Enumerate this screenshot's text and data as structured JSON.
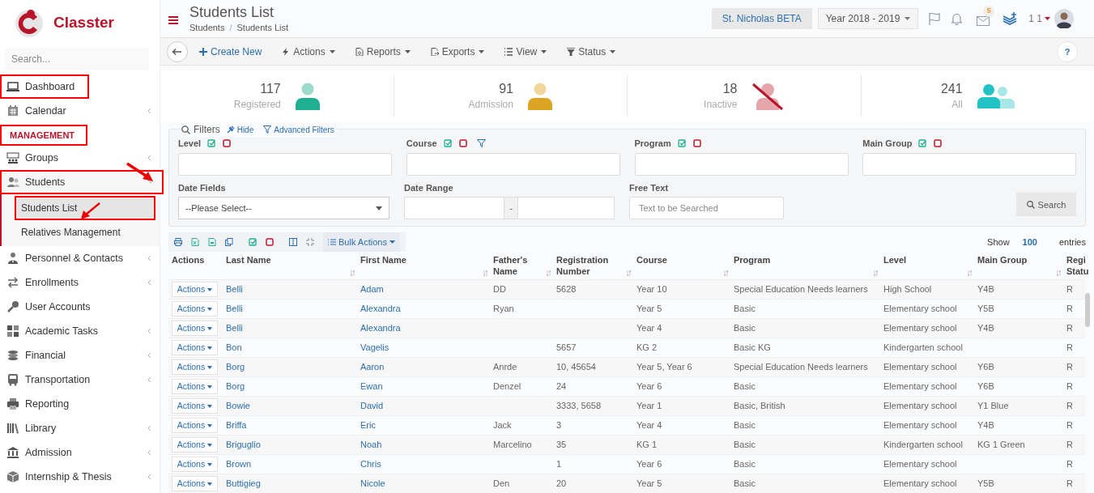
{
  "brand": {
    "name": "Classter"
  },
  "sidebar": {
    "search": {
      "placeholder": "Search..."
    },
    "items": [
      {
        "kind": "link",
        "label": "Dashboard",
        "annotated": true,
        "selected": false
      },
      {
        "kind": "link",
        "label": "Calendar",
        "annotated": false,
        "selected": false,
        "expanded": false
      },
      {
        "kind": "section",
        "label": "MANAGEMENT",
        "annotated": true
      },
      {
        "kind": "link",
        "label": "Groups",
        "annotated": false,
        "selected": false,
        "expanded": false
      },
      {
        "kind": "link",
        "label": "Students",
        "annotated": true,
        "selected": false,
        "expanded": true,
        "children": [
          {
            "label": "Students List",
            "selected": true,
            "annotated": true
          },
          {
            "label": "Relatives Management",
            "selected": false,
            "annotated": false
          }
        ]
      },
      {
        "kind": "link",
        "label": "Personnel & Contacts",
        "annotated": false,
        "selected": false,
        "expanded": false
      },
      {
        "kind": "link",
        "label": "Enrollments",
        "annotated": false,
        "selected": false,
        "expanded": false
      },
      {
        "kind": "link",
        "label": "User Accounts",
        "annotated": false,
        "selected": false
      },
      {
        "kind": "link",
        "label": "Academic Tasks",
        "annotated": false,
        "selected": false,
        "expanded": false
      },
      {
        "kind": "link",
        "label": "Financial",
        "annotated": false,
        "selected": false,
        "expanded": false
      },
      {
        "kind": "link",
        "label": "Transportation",
        "annotated": false,
        "selected": false,
        "expanded": false
      },
      {
        "kind": "link",
        "label": "Reporting",
        "annotated": false,
        "selected": false
      },
      {
        "kind": "link",
        "label": "Library",
        "annotated": false,
        "selected": false,
        "expanded": false
      },
      {
        "kind": "link",
        "label": "Admission",
        "annotated": false,
        "selected": false,
        "expanded": false
      },
      {
        "kind": "link",
        "label": "Internship & Thesis",
        "annotated": false,
        "selected": false,
        "expanded": false
      }
    ]
  },
  "header": {
    "title": "Students List",
    "breadcrumb": [
      "Students",
      "Students List"
    ],
    "breadcrumb_separator": "/",
    "school": "St. Nicholas BETA",
    "year": "Year 2018 - 2019",
    "mail_badge": "5",
    "user": "1 1"
  },
  "toolbar": [
    "Create New",
    "Actions",
    "Reports",
    "Exports",
    "View",
    "Status"
  ],
  "help": "?",
  "stats": [
    {
      "count": "117",
      "label": "Registered",
      "kind": "person",
      "color": "#1fb091"
    },
    {
      "count": "91",
      "label": "Admission",
      "kind": "person",
      "color": "#dba422"
    },
    {
      "count": "18",
      "label": "Inactive",
      "kind": "crossed",
      "color": "#e4a5ab"
    },
    {
      "count": "241",
      "label": "All",
      "kind": "group",
      "color": "#22c2c5"
    }
  ],
  "filters": {
    "title": "Filters",
    "hide": "Hide",
    "advanced": "Advanced Filters",
    "fields": [
      {
        "label": "Level",
        "funnel": false
      },
      {
        "label": "Course",
        "funnel": true
      },
      {
        "label": "Program",
        "funnel": false
      },
      {
        "label": "Main Group",
        "funnel": false
      }
    ],
    "date_fields": {
      "label": "Date Fields",
      "value": "--Please Select--"
    },
    "date_range": {
      "label": "Date Range",
      "separator": "-"
    },
    "free_text": {
      "label": "Free Text",
      "placeholder": "Text to be Searched"
    },
    "search_button": "Search"
  },
  "table": {
    "bulk_actions": "Bulk Actions",
    "show": "Show",
    "page_size": "100",
    "entries": "entries",
    "columns": [
      "Actions",
      "Last Name",
      "First Name",
      "Father's Name",
      "Registration Number",
      "Course",
      "Program",
      "Level",
      "Main Group",
      "Regi Statu"
    ],
    "rows": [
      [
        "Actions",
        "Belli",
        "Adam",
        "DD",
        "5628",
        "Year 10",
        "Special Education Needs learners",
        "High School",
        "Y4B",
        "R"
      ],
      [
        "Actions",
        "Belli",
        "Alexandra",
        "Ryan",
        "",
        "Year 5",
        "Basic",
        "Elementary school",
        "Y5B",
        "R"
      ],
      [
        "Actions",
        "Belli",
        "Alexandra",
        "",
        "",
        "Year 4",
        "Basic",
        "Elementary school",
        "Y4B",
        "R"
      ],
      [
        "Actions",
        "Bon",
        "Vagelis",
        "",
        "5657",
        "KG 2",
        "Basic KG",
        "Kindergarten school",
        "",
        "R"
      ],
      [
        "Actions",
        "Borg",
        "Aaron",
        "Anrde",
        "10, 45654",
        "Year 5, Year 6",
        "Special Education Needs learners",
        "Elementary school",
        "Y6B",
        "R"
      ],
      [
        "Actions",
        "Borg",
        "Ewan",
        "Denzel",
        "24",
        "Year 6",
        "Basic",
        "Elementary school",
        "Y6B",
        "R"
      ],
      [
        "Actions",
        "Bowie",
        "David",
        "",
        "3333, 5658",
        "Year 1",
        "Basic, British",
        "Elementary school",
        "Y1 Blue",
        "R"
      ],
      [
        "Actions",
        "Briffa",
        "Eric",
        "Jack",
        "3",
        "Year 4",
        "Basic",
        "Elementary school",
        "Y4B",
        "R"
      ],
      [
        "Actions",
        "Briguglio",
        "Noah",
        "Marcelino",
        "35",
        "KG 1",
        "Basic",
        "Kindergarten school",
        "KG 1 Green",
        "R"
      ],
      [
        "Actions",
        "Brown",
        "Chris",
        "",
        "1",
        "Year 6",
        "Basic",
        "Elementary school",
        "",
        "R"
      ],
      [
        "Actions",
        "Buttigieg",
        "Nicole",
        "Den",
        "20",
        "Year 5",
        "Basic",
        "Elementary school",
        "Y5B",
        "R"
      ]
    ]
  }
}
